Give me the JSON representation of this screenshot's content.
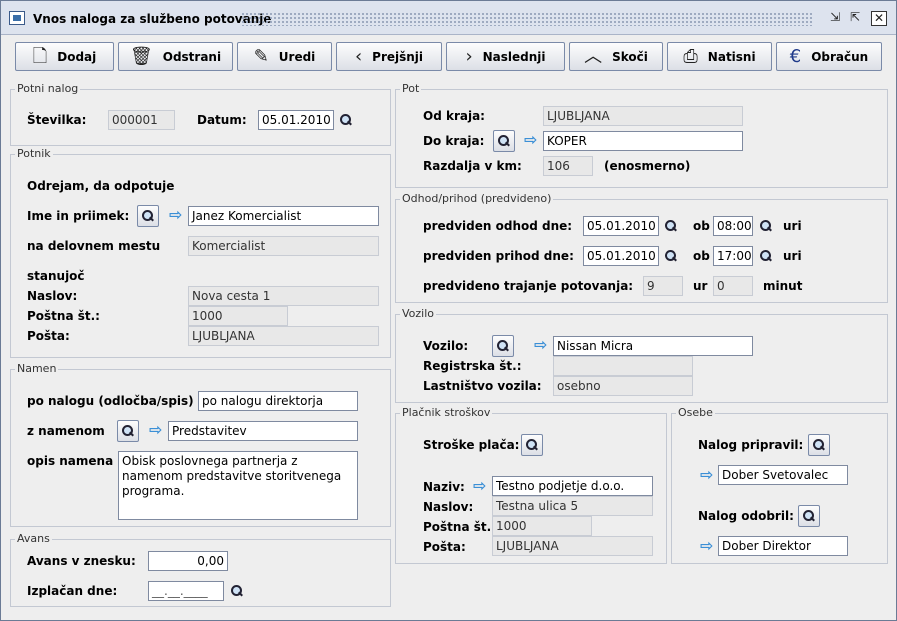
{
  "window": {
    "title": "Vnos naloga za službeno potovanje"
  },
  "toolbar": {
    "dodaj": "Dodaj",
    "odstrani": "Odstrani",
    "uredi": "Uredi",
    "prejsnji": "Prejšnji",
    "naslednji": "Naslednji",
    "skoci": "Skoči",
    "natisni": "Natisni",
    "obracun": "Obračun"
  },
  "potni_nalog": {
    "legend": "Potni nalog",
    "stevilka_label": "Številka:",
    "stevilka": "000001",
    "datum_label": "Datum:",
    "datum": "05.01.2010"
  },
  "potnik": {
    "legend": "Potnik",
    "odrejam": "Odrejam, da odpotuje",
    "ime_label": "Ime in priimek:",
    "ime": "Janez Komercialist",
    "mesto_label": "na delovnem mestu",
    "mesto": "Komercialist",
    "stanujoc": "stanujoč",
    "naslov_label": "Naslov:",
    "naslov": "Nova cesta 1",
    "posta_st_label": "Poštna št.:",
    "posta_st": "1000",
    "posta_label": "Pošta:",
    "posta": "LJUBLJANA"
  },
  "namen": {
    "legend": "Namen",
    "po_nalogu_label": "po nalogu (odločba/spis)",
    "po_nalogu": "po nalogu direktorja",
    "z_namenom_label": "z namenom",
    "z_namenom": "Predstavitev",
    "opis_label": "opis namena",
    "opis": "Obisk poslovnega partnerja z namenom predstavitve storitvenega programa."
  },
  "avans": {
    "legend": "Avans",
    "znesek_label": "Avans v znesku:",
    "znesek": "0,00",
    "izplacan_label": "Izplačan dne:",
    "izplacan": "__.__.____"
  },
  "pot": {
    "legend": "Pot",
    "od_label": "Od kraja:",
    "od": "LJUBLJANA",
    "do_label": "Do kraja:",
    "do": "KOPER",
    "razdalja_label": "Razdalja v km:",
    "razdalja": "106",
    "smer": "(enosmerno)"
  },
  "odhod": {
    "legend": "Odhod/prihod (predvideno)",
    "odhod_label": "predviden odhod dne:",
    "odhod_datum": "05.01.2010",
    "ob": "ob",
    "odhod_ura": "08:00",
    "uri": "uri",
    "prihod_label": "predviden prihod dne:",
    "prihod_datum": "05.01.2010",
    "prihod_ura": "17:00",
    "trajanje_label": "predvideno trajanje potovanja:",
    "ur_val": "9",
    "ur": "ur",
    "min_val": "0",
    "minut": "minut"
  },
  "vozilo": {
    "legend": "Vozilo",
    "vozilo_label": "Vozilo:",
    "vozilo": "Nissan Micra",
    "reg_label": "Registrska št.:",
    "reg": "",
    "last_label": "Lastništvo vozila:",
    "last": "osebno"
  },
  "placnik": {
    "legend": "Plačnik stroškov",
    "placa_label": "Stroške plača:",
    "naziv_label": "Naziv:",
    "naziv": "Testno podjetje d.o.o.",
    "naslov_label": "Naslov:",
    "naslov": "Testna ulica 5",
    "posta_st_label": "Poštna št.:",
    "posta_st": "1000",
    "posta_label": "Pošta:",
    "posta": "LJUBLJANA"
  },
  "osebe": {
    "legend": "Osebe",
    "pripravil_label": "Nalog pripravil:",
    "pripravil": "Dober Svetovalec",
    "odobril_label": "Nalog odobril:",
    "odobril": "Dober Direktor"
  }
}
